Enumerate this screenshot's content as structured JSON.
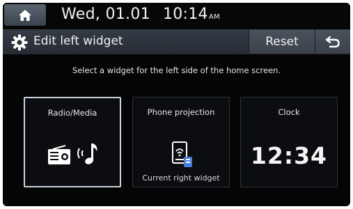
{
  "status_bar": {
    "date": "Wed, 01.01",
    "time": "10:14",
    "ampm": "AM",
    "home_icon": "home-icon"
  },
  "title_bar": {
    "title": "Edit left widget",
    "settings_icon": "gear-icon",
    "reset_label": "Reset",
    "back_icon": "back-arrow-icon"
  },
  "instruction": "Select a widget for the left side of the home screen.",
  "widgets": [
    {
      "title": "Radio/Media",
      "icon": "radio-icon",
      "icon2": "music-note-icon",
      "selected": true,
      "subtitle": ""
    },
    {
      "title": "Phone projection",
      "icon": "phone-projection-icon",
      "selected": false,
      "subtitle": "Current right widget"
    },
    {
      "title": "Clock",
      "selected": false,
      "display": "12:34",
      "subtitle": ""
    }
  ],
  "colors": {
    "screen_bg": "#050505",
    "titlebar": "#2f353e",
    "selected_border": "#c9d3de",
    "text": "#e9e9e9"
  }
}
